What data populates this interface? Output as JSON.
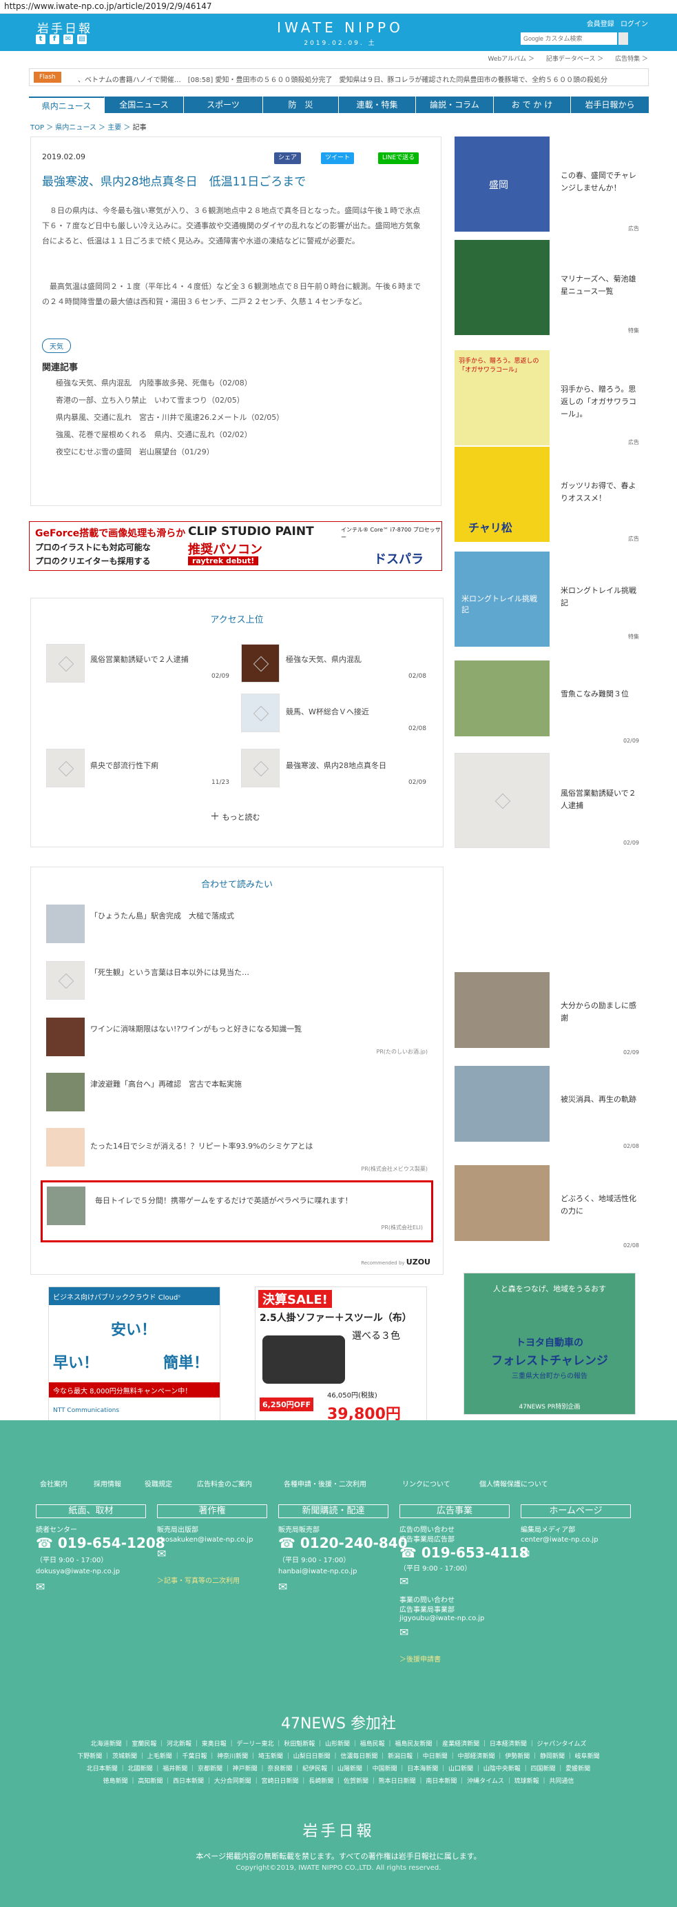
{
  "url": "https://www.iwate-np.co.jp/article/2019/2/9/46147",
  "header": {
    "logo_ja": "岩手日報",
    "brand": "IWATE NIPPO",
    "date_line": "2019.02.09. 土",
    "links": [
      "会員登録",
      "ログイン"
    ],
    "search_placeholder": "Google カスタム検索",
    "sub_links": [
      "Webアルバム ＞",
      "記事データベース ＞",
      "広告特集 ＞"
    ],
    "social_icons": [
      "twitter-icon",
      "facebook-icon",
      "mail-icon",
      "print-icon"
    ]
  },
  "flash": {
    "label": "Flash",
    "text": "、ベトナムの書籍ハノイで開催…　[08:58] 愛知・豊田市の５６００頭殺処分完了　愛知県は９日、豚コレラが確認された同県豊田市の養豚場で、全約５６００頭の殺処分"
  },
  "nav": [
    "県内ニュース",
    "全国ニュース",
    "スポーツ",
    "防　災",
    "連載・特集",
    "論説・コラム",
    "お で か け",
    "岩手日報から"
  ],
  "breadcrumb": {
    "items": [
      "TOP",
      "県内ニュース",
      "主要"
    ],
    "current": "記事"
  },
  "article": {
    "date": "2019.02.09",
    "share": [
      "シェア",
      "ツイート",
      "LINEで送る"
    ],
    "title": "最強寒波、県内28地点真冬日　低温11日ごろまで",
    "p1": "　８日の県内は、今冬最も強い寒気が入り、３６観測地点中２８地点で真冬日となった。盛岡は午後１時で氷点下６・７度など日中も厳しい冷え込みに。交通事故や交通機関のダイヤの乱れなどの影響が出た。盛岡地方気象台によると、低温は１１日ごろまで続く見込み。交通障害や水道の凍結などに警戒が必要だ。",
    "p2": "　最高気温は盛岡同２・１度（平年比４・４度低）など全３６観測地点で８日午前０時台に観測。午後６時までの２４時間降雪量の最大値は西和賀・湯田３６センチ、二戸２２センチ、久慈１４センチなど。",
    "tag": "天気",
    "related_heading": "関連記事",
    "related": [
      "極強な天気、県内混乱　内陸事故多発、死傷も（02/08）",
      "寄港の一部、立ち入り禁止　いわて雪まつり（02/05）",
      "県内暴風、交通に乱れ　宮古・川井で風速26.2メートル（02/05）",
      "強風、花巻で屋根めくれる　県内、交通に乱れ（02/02）",
      "夜空にむせぶ雪の盛岡　岩山展望台（01/29）"
    ]
  },
  "banner_ad": {
    "left1": "GeForce搭載で画像処理も滑らか",
    "left2": "プロのイラストにも対応可能な",
    "left3": "プロのクリエイターも採用する",
    "center1": "CLIP STUDIO PAINT",
    "center2": "推奨パソコン",
    "center3": "raytrek debut!",
    "right1": "インテル® Core™ i7-8700 プロセッサー",
    "right2": "ドスパラ"
  },
  "access_ranking": {
    "title": "アクセス上位",
    "items": [
      {
        "title": "風俗営業勧誘疑いで２人逮捕",
        "date": "02/09"
      },
      {
        "title": "極強な天気、県内混乱",
        "date": "02/08"
      },
      {
        "title": "競馬、W杯総合Ｖへ接近",
        "date": "02/08"
      },
      {
        "title": "県央で部流行性下痢",
        "date": "11/23"
      },
      {
        "title": "最強寒波、県内28地点真冬日",
        "date": "02/09"
      }
    ],
    "more": "もっと読む"
  },
  "recommend": {
    "title": "合わせて読みたい",
    "items": [
      {
        "title": "「ひょうたん島」駅舎完成　大槌で落成式",
        "pr": ""
      },
      {
        "title": "「死生観」という言葉は日本以外には見当た…",
        "pr": ""
      },
      {
        "title": "ワインに消味期限はない!?ワインがもっと好きになる知識一覧",
        "pr": "PR(たのしいお酒.jp)"
      },
      {
        "title": "津波避難「高台へ」再確認　宮古で本転実施",
        "pr": ""
      },
      {
        "title": "たった14日でシミが消える！？リピート率93.9%のシミケアとは",
        "pr": "PR(株式会社メビウス製薬)"
      },
      {
        "title": "毎日トイレで５分間！携帯ゲームをするだけで英語がペラペラに喋れます！",
        "pr": "PR(株式会社ELI)"
      }
    ],
    "powered": "Recommended by",
    "powered_brand": "UZOU"
  },
  "bottom_ads": [
    {
      "line1": "ビジネス向けパブリッククラウド Cloudˢ",
      "line2": "安い！",
      "line3": "早い！",
      "line4": "簡単！",
      "line5": "今なら最大 8,000円分無料キャンペーン中！",
      "line6": "NTT Communications"
    },
    {
      "line1": "決算SALE!",
      "line2": "2.5人掛ソファー＋スツール（布）",
      "line3": "選べる３色",
      "line4": "6,250円OFF",
      "line5": "39,800円",
      "line6": "46,050円(税抜)"
    },
    {
      "line1": "人と森をつなげ、地域をうるおす",
      "line2": "トヨタ自動車の",
      "line3": "フォレストチャレンジ",
      "line4": "三重県大台町からの報告",
      "line5": "47NEWS PR特別企画"
    }
  ],
  "sidebar": [
    {
      "title": "この春、盛岡でチャレンジしませんか！",
      "tag": "広告"
    },
    {
      "title": "マリナーズへ、菊池雄星ニュース一覧",
      "tag": "特集"
    },
    {
      "title": "羽手から、贈ろう。思返しの「オガサワラコール」。",
      "tag": "広告"
    },
    {
      "title": "ガッツリお得で、春よりオススメ！",
      "tag": "広告"
    },
    {
      "title": "米ロングトレイル挑戦記",
      "tag": "特集"
    },
    {
      "title": "雪魚こなみ難関３位",
      "tag": "02/09"
    },
    {
      "title": "風俗営業勧誘疑いで２人逮捕",
      "tag": "02/09"
    },
    {
      "title": "大分からの励ましに感謝",
      "tag": "02/09"
    },
    {
      "title": "被災消具、再生の軌跡",
      "tag": "02/08"
    },
    {
      "title": "どぶろく、地域活性化の力に",
      "tag": "02/08"
    }
  ],
  "sidebar_img_text": {
    "ad1": "盛岡",
    "ad3": "羽手から、贈ろう。思返しの「オガサワラコール」",
    "ad4": "チャリ松",
    "ad5": "米ロングトレイル挑戦記"
  },
  "footer": {
    "links": [
      "会社案内",
      "採用情報",
      "役職規定",
      "広告料金のご案内",
      "各種申請・後援・二次利用",
      "リンクについて",
      "個人情報保護について"
    ],
    "cols": [
      {
        "head": "紙面、取材",
        "lines": [
          "読者センター",
          "019-654-1208",
          "（平日 9:00 - 17:00）",
          "dokusya@iwate-np.co.jp"
        ],
        "accent": ""
      },
      {
        "head": "著作権",
        "lines": [
          "販売局出版部",
          "chosakuken@iwate-np.co.jp"
        ],
        "accent": "＞記事・写真等の二次利用"
      },
      {
        "head": "新聞購読・配達",
        "lines": [
          "販売局販売部",
          "0120-240-840",
          "（平日 9:00 - 17:00）",
          "hanbai@iwate-np.co.jp"
        ],
        "accent": ""
      },
      {
        "head": "広告事業",
        "lines": [
          "広告の問い合わせ",
          "広告事業局広告部",
          "019-653-4118",
          "（平日 9:00 - 17:00）",
          "kokoku@iwate-np.co.jp",
          "事業の問い合わせ",
          "広告事業局事業部",
          "jigyoubu@iwate-np.co.jp"
        ],
        "accent": "＞後援申請書"
      },
      {
        "head": "ホームページ",
        "lines": [
          "編集局メディア部",
          "center@iwate-np.co.jp"
        ],
        "accent": ""
      }
    ],
    "news47": "47NEWS 参加社",
    "partners": [
      "北海道新聞 ｜ 室蘭民報 ｜ 河北新報 ｜ 東奥日報 ｜ デーリー東北 ｜ 秋田魁新報 ｜ 山形新聞 ｜ 福島民報 ｜ 福島民友新聞 ｜ 産業経済新聞 ｜ 日本経済新聞 ｜ ジャパンタイムズ",
      "下野新聞 ｜ 茨城新聞 ｜ 上毛新聞 ｜ 千葉日報 ｜ 神奈川新聞 ｜ 埼玉新聞 ｜ 山梨日日新聞 ｜ 信濃毎日新聞 ｜ 新潟日報 ｜ 中日新聞 ｜ 中部経済新聞 ｜ 伊勢新聞 ｜ 静岡新聞 ｜ 岐阜新聞",
      "北日本新聞 ｜ 北國新聞 ｜ 福井新聞 ｜ 京都新聞 ｜ 神戸新聞 ｜ 奈良新聞 ｜ 紀伊民報 ｜ 山陽新聞 ｜ 中国新聞 ｜ 日本海新聞 ｜ 山口新聞 ｜ 山陰中央新報 ｜ 四国新聞 ｜ 愛媛新聞",
      "徳島新聞 ｜ 高知新聞 ｜ 西日本新聞 ｜ 大分合同新聞 ｜ 宮崎日日新聞 ｜ 長崎新聞 ｜ 佐賀新聞 ｜ 熊本日日新聞 ｜ 南日本新聞 ｜ 沖縄タイムス ｜ 琉球新報 ｜ 共同通信"
    ],
    "logo": "岩手日報",
    "note": "本ページ掲載内容の無断転載を禁じます。すべての著作権は岩手日報社に属します。",
    "copyright": "Copyright©2019, IWATE NIPPO CO.,LTD. All rights reserved."
  }
}
